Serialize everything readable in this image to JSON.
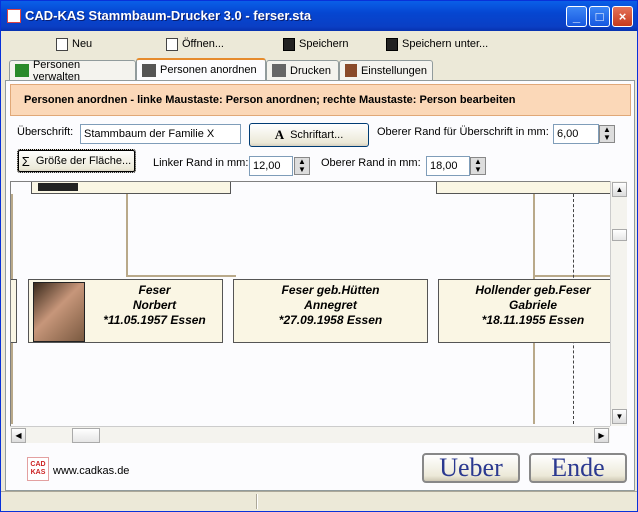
{
  "window": {
    "title": "CAD-KAS Stammbaum-Drucker 3.0 - ferser.sta"
  },
  "title_buttons": {
    "minimize": "_",
    "maximize": "□",
    "close": "×"
  },
  "menu": {
    "items": [
      {
        "label": "Neu",
        "icon": "new-file-icon"
      },
      {
        "label": "Öffnen...",
        "icon": "open-file-icon"
      },
      {
        "label": "Speichern",
        "icon": "floppy-disk-icon"
      },
      {
        "label": "Speichern unter...",
        "icon": "floppy-disk-edit-icon"
      }
    ]
  },
  "tabs": [
    {
      "label": "Personen verwalten",
      "icon": "person-walk-icon"
    },
    {
      "label": "Personen anordnen",
      "icon": "people-icon",
      "active": true
    },
    {
      "label": "Drucken",
      "icon": "printer-icon"
    },
    {
      "label": "Einstellungen",
      "icon": "tools-icon"
    }
  ],
  "info": "Personen anordnen - linke Maustaste: Person anordnen; rechte Maustaste: Person bearbeiten",
  "form": {
    "heading_label": "Überschrift:",
    "heading_value": "Stammbaum der Familie X",
    "font_button": "Schriftart...",
    "top_margin_heading_label": "Oberer Rand für Überschrift in mm:",
    "top_margin_heading_value": "6,00",
    "area_size_button": "Größe der Fläche...",
    "left_margin_label": "Linker Rand in mm:",
    "left_margin_value": "12,00",
    "top_margin_label": "Oberer Rand in mm:",
    "top_margin_value": "18,00"
  },
  "persons": [
    {
      "surname": "Feser",
      "firstname": "Norbert",
      "birth": "*11.05.1957 Essen",
      "has_photo": true
    },
    {
      "surname": "Feser geb.Hütten",
      "firstname": "Annegret",
      "birth": "*27.09.1958 Essen"
    },
    {
      "surname": "Hollender geb.Feser",
      "firstname": "Gabriele",
      "birth": "*18.11.1955 Essen"
    }
  ],
  "footer": {
    "logo_text": "CAD KAS",
    "url": "www.cadkas.de",
    "about_button": "Ueber",
    "exit_button": "Ende"
  },
  "colors": {
    "titlebar": "#0546d1",
    "info_bg": "#fbd8b8",
    "card_bg": "#faf6e4",
    "big_button_text": "#2b3990"
  }
}
